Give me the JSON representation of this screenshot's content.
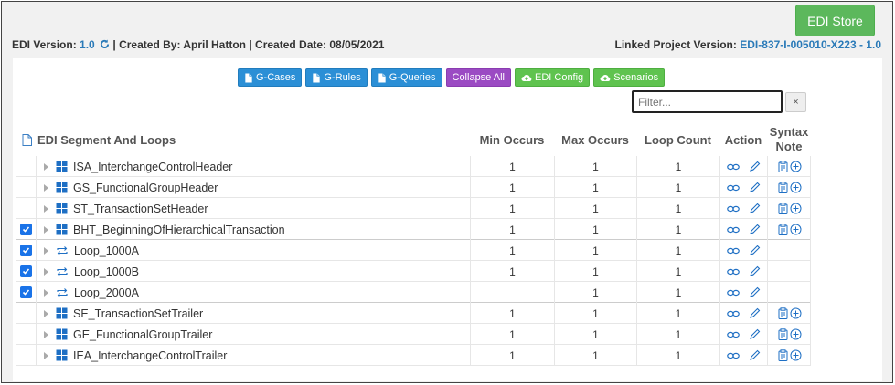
{
  "header": {
    "store_label": "EDI Store",
    "edi_version_label": "EDI Version:",
    "edi_version": "1.0",
    "created_by": "| Created By: April Hatton | Created Date: 08/05/2021",
    "linked_label": "Linked Project Version:",
    "linked_version": "EDI-837-I-005010-X223 - 1.0"
  },
  "toolbar": {
    "gcases": "G-Cases",
    "grules": "G-Rules",
    "gqueries": "G-Queries",
    "collapse": "Collapse All",
    "config": "EDI Config",
    "scenarios": "Scenarios"
  },
  "filter": {
    "placeholder": "Filter...",
    "clear": "×"
  },
  "grid": {
    "title": "EDI Segment And Loops",
    "columns": {
      "min": "Min Occurs",
      "max": "Max Occurs",
      "loop": "Loop Count",
      "action": "Action",
      "syntax1": "Syntax",
      "syntax2": "Note"
    },
    "rows": [
      {
        "name": "ISA_InterchangeControlHeader",
        "kind": "segment",
        "checked": false,
        "min": "1",
        "max": "1",
        "loop": "1",
        "syntax": true
      },
      {
        "name": "GS_FunctionalGroupHeader",
        "kind": "segment",
        "checked": false,
        "min": "1",
        "max": "1",
        "loop": "1",
        "syntax": true
      },
      {
        "name": "ST_TransactionSetHeader",
        "kind": "segment",
        "checked": false,
        "min": "1",
        "max": "1",
        "loop": "1",
        "syntax": true
      },
      {
        "name": "BHT_BeginningOfHierarchicalTransaction",
        "kind": "segment",
        "checked": true,
        "min": "1",
        "max": "1",
        "loop": "1",
        "syntax": true
      },
      {
        "name": "Loop_1000A",
        "kind": "loop",
        "checked": true,
        "min": "1",
        "max": "1",
        "loop": "1",
        "syntax": false
      },
      {
        "name": "Loop_1000B",
        "kind": "loop",
        "checked": true,
        "min": "1",
        "max": "1",
        "loop": "1",
        "syntax": false
      },
      {
        "name": "Loop_2000A",
        "kind": "loop",
        "checked": true,
        "min": "",
        "max": "1",
        "loop": "1",
        "syntax": false
      },
      {
        "name": "SE_TransactionSetTrailer",
        "kind": "segment",
        "checked": false,
        "min": "1",
        "max": "1",
        "loop": "1",
        "syntax": true
      },
      {
        "name": "GE_FunctionalGroupTrailer",
        "kind": "segment",
        "checked": false,
        "min": "1",
        "max": "1",
        "loop": "1",
        "syntax": true
      },
      {
        "name": "IEA_InterchangeControlTrailer",
        "kind": "segment",
        "checked": false,
        "min": "1",
        "max": "1",
        "loop": "1",
        "syntax": true
      }
    ]
  },
  "colors": {
    "store": "#5cb85c",
    "link": "#2a7ab8",
    "blue_btn": "#2b8fd6",
    "purple_btn": "#9b4bc3",
    "green_btn": "#5fc34f",
    "checkbox": "#1a73e8",
    "icon": "#1e6fc4"
  }
}
